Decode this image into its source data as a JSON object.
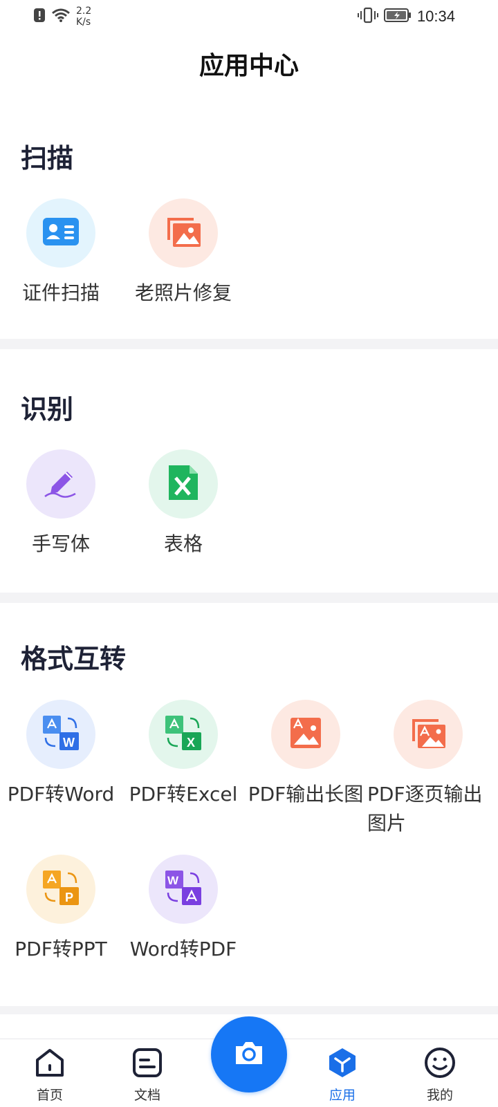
{
  "status_bar": {
    "net_speed_value": "2.2",
    "net_speed_unit": "K/s",
    "time": "10:34"
  },
  "header": {
    "title": "应用中心"
  },
  "sections": [
    {
      "title": "扫描",
      "tools": [
        {
          "label": "证件扫描",
          "icon": "id-card-icon",
          "bg": "#e3f4fd"
        },
        {
          "label": "老照片修复",
          "icon": "photo-restore-icon",
          "bg": "#fde9e2"
        }
      ]
    },
    {
      "title": "识别",
      "tools": [
        {
          "label": "手写体",
          "icon": "handwriting-pen-icon",
          "bg": "#ece6fb"
        },
        {
          "label": "表格",
          "icon": "excel-sheet-icon",
          "bg": "#e3f6ec"
        }
      ]
    },
    {
      "title": "格式互转",
      "tools": [
        {
          "label": "PDF转Word",
          "icon": "pdf-to-word-icon",
          "bg": "#e6eefd"
        },
        {
          "label": "PDF转Excel",
          "icon": "pdf-to-excel-icon",
          "bg": "#e3f6ec"
        },
        {
          "label": "PDF输出长图",
          "icon": "pdf-long-image-icon",
          "bg": "#fde9e2"
        },
        {
          "label": "PDF逐页输出图片",
          "icon": "pdf-page-images-icon",
          "bg": "#fde9e2"
        },
        {
          "label": "PDF转PPT",
          "icon": "pdf-to-ppt-icon",
          "bg": "#fdf1dc"
        },
        {
          "label": "Word转PDF",
          "icon": "word-to-pdf-icon",
          "bg": "#ece6fb"
        }
      ]
    }
  ],
  "bottom_nav": {
    "items": [
      {
        "label": "首页",
        "icon": "home-icon"
      },
      {
        "label": "文档",
        "icon": "document-icon"
      },
      {
        "label": "应用",
        "icon": "apps-cube-icon",
        "active": true
      },
      {
        "label": "我的",
        "icon": "smile-profile-icon"
      }
    ],
    "camera": {
      "icon": "camera-icon"
    }
  },
  "colors": {
    "accent": "#1677f5",
    "active_nav": "#1a6fe8",
    "divider": "#f3f3f5"
  }
}
